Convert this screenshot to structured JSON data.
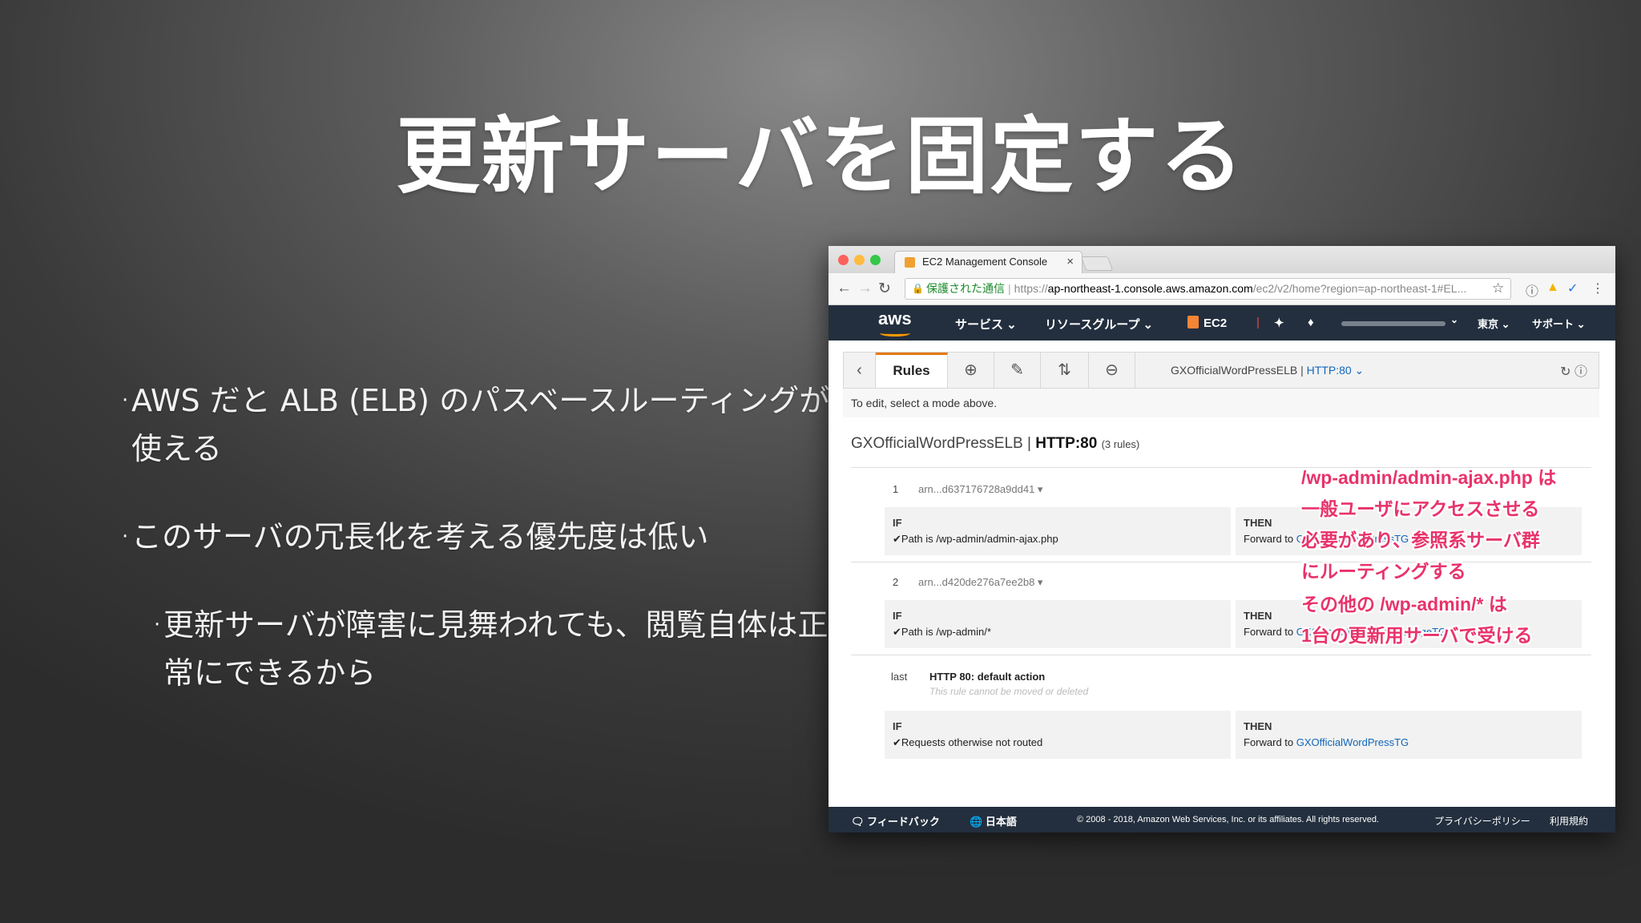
{
  "slide": {
    "title": "更新サーバを固定する",
    "bullets": [
      "AWS だと ALB (ELB) のパスベースルーティングが使える",
      "このサーバの冗長化を考える優先度は低い",
      "更新サーバが障害に見舞われても、閲覧自体は正常にできるから"
    ],
    "bullet_marker": "·"
  },
  "browser": {
    "tab_title": "EC2 Management Console",
    "tab_close": "×",
    "url_secure": "保護された通信",
    "url_scheme": "https://",
    "url_host": "ap-northeast-1.console.aws.amazon.com",
    "url_path": "/ec2/v2/home?region=ap-northeast-1#EL...",
    "icons": {
      "back": "←",
      "forward": "→",
      "reload": "↻",
      "star": "☆"
    }
  },
  "aws_nav": {
    "logo": "aws",
    "services": "サービス ⌄",
    "resource_groups": "リソースグループ ⌄",
    "service_name": "EC2",
    "region": "東京 ⌄",
    "support": "サポート ⌄"
  },
  "rules_page": {
    "rules_tab": "Rules",
    "lb_name": "GXOfficialWordPressELB",
    "listener": "HTTP:80",
    "listener_dropdown": "HTTP:80 ⌄",
    "hint": "To edit, select a mode above.",
    "rule_count": "(3 rules)",
    "rules": [
      {
        "num": "1",
        "arn": "arn...d637176728a9dd41 ▾",
        "if_label": "IF",
        "condition": "Path is /wp-admin/admin-ajax.php",
        "then_label": "THEN",
        "forward_to": "Forward to",
        "target": "GXOfficialWordPressTG"
      },
      {
        "num": "2",
        "arn": "arn...d420de276a7ee2b8 ▾",
        "if_label": "IF",
        "condition": "Path is /wp-admin/*",
        "then_label": "THEN",
        "forward_to": "Forward to",
        "target": "GXOfficialWordPressManageTG"
      }
    ],
    "default_rule": {
      "num": "last",
      "title": "HTTP 80: default action",
      "subtitle": "This rule cannot be moved or deleted",
      "if_label": "IF",
      "condition": "Requests otherwise not routed",
      "then_label": "THEN",
      "forward_to": "Forward to",
      "target": "GXOfficialWordPressTG"
    }
  },
  "annotations": [
    "/wp-admin/admin-ajax.php は",
    "一般ユーザにアクセスさせる",
    "必要があり、参照系サーバ群",
    "にルーティングする",
    "その他の /wp-admin/* は",
    "1台の更新用サーバで受ける"
  ],
  "footer": {
    "feedback": "フィードバック",
    "language": "日本語",
    "copyright": "© 2008 - 2018, Amazon Web Services, Inc. or its affiliates. All rights reserved.",
    "privacy": "プライバシーポリシー",
    "terms": "利用規約"
  }
}
